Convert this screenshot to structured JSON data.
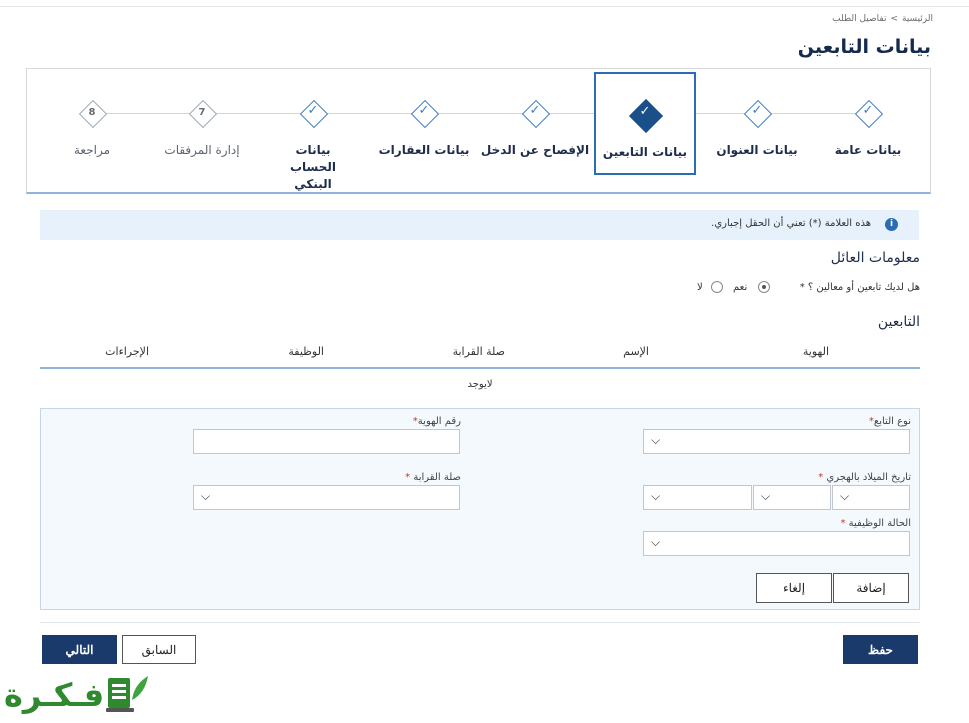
{
  "breadcrumb": {
    "home": "الرئيسية",
    "separator": ">",
    "current": "تفاصيل الطلب"
  },
  "page_title": "بيانات التابعين",
  "steps": [
    {
      "label": "بيانات عامة",
      "state": "done"
    },
    {
      "label": "بيانات العنوان",
      "state": "done"
    },
    {
      "label": "بيانات التابعين",
      "state": "active"
    },
    {
      "label": "الإفصاح عن الدخل",
      "state": "done"
    },
    {
      "label": "بيانات العقارات",
      "state": "done"
    },
    {
      "label": "بيانات الحساب البنكي",
      "state": "done"
    },
    {
      "label": "إدارة المرفقات",
      "state": "pending",
      "number": "7"
    },
    {
      "label": "مراجعة",
      "state": "pending",
      "number": "8"
    }
  ],
  "info": {
    "icon": "info-icon",
    "text": "هذه العلامة (*) تعني أن الحقل إجباري."
  },
  "family_info": {
    "title": "معلومات العائل",
    "question": "هل لديك تابعين أو معالين ؟ *",
    "options": [
      {
        "label": "نعم",
        "checked": true
      },
      {
        "label": "لا",
        "checked": false
      }
    ]
  },
  "dependents": {
    "title": "التابعين",
    "columns": [
      "الهوية",
      "الإسم",
      "صلة القرابة",
      "الوظيفة",
      "الإجراءات"
    ],
    "empty_text": "لايوجد"
  },
  "form": {
    "dependent_type_label": "نوع التابع",
    "id_number_label": "رقم الهوية",
    "birth_date_label": "تاريخ الميلاد بالهجري",
    "relation_label": "صلة القرابة",
    "job_status_label": "الحالة الوظيفية",
    "required_mark": "*",
    "add_button": "إضافة",
    "cancel_button": "إلغاء"
  },
  "footer": {
    "save_button": "حفظ",
    "previous_button": "السابق",
    "next_button": "التالي"
  },
  "watermark": {
    "text": "فـكـرة"
  },
  "colors": {
    "primary": "#1a3a6b",
    "accent": "#2a6db5",
    "info_bg": "#e6f1fb",
    "watermark": "#2f8a2f"
  }
}
